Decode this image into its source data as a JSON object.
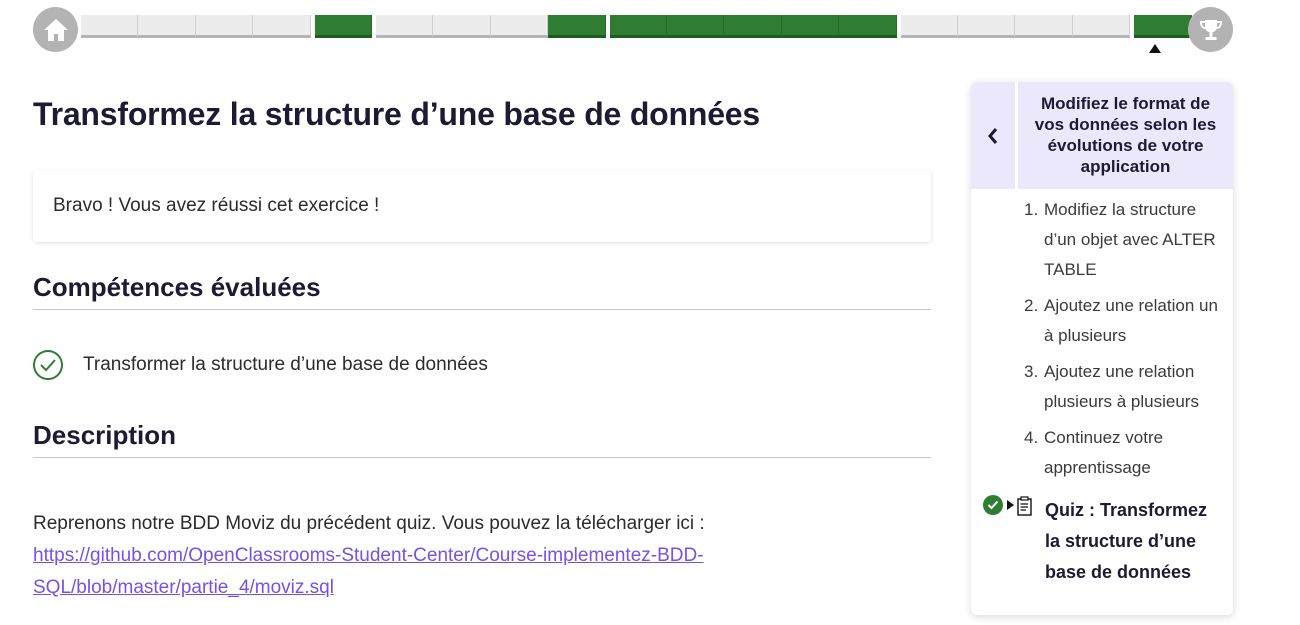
{
  "colors": {
    "accent_green": "#2e7d32",
    "link_purple": "#7451eb",
    "sidebar_header_bg": "#ebe8fb",
    "progress_empty": "#ececec",
    "nav_circle": "#b3b3b3"
  },
  "progress": {
    "home_icon": "home-icon",
    "trophy_icon": "trophy-icon",
    "segments": [
      {
        "done": false
      },
      {
        "done": false
      },
      {
        "done": false
      },
      {
        "done": false
      },
      {
        "done": true
      },
      {
        "done": false
      },
      {
        "done": false
      },
      {
        "done": false
      },
      {
        "done": true
      },
      {
        "done": true
      },
      {
        "done": true
      },
      {
        "done": true
      },
      {
        "done": true
      },
      {
        "done": true
      },
      {
        "done": false
      },
      {
        "done": false
      },
      {
        "done": false
      },
      {
        "done": false
      },
      {
        "done": true
      }
    ],
    "current_index": 18
  },
  "main": {
    "title": "Transformez la structure d’une base de données",
    "success_message": "Bravo ! Vous avez réussi cet exercice !",
    "skills_heading": "Compétences évaluées",
    "skills": [
      "Transformer la structure d’une base de données"
    ],
    "description_heading": "Description",
    "description_text": "Reprenons notre BDD Moviz du précédent quiz. Vous pouvez la télécharger ici :",
    "description_link": "https://github.com/OpenClassrooms-Student-Center/Course-implementez-BDD-SQL/blob/master/partie_4/moviz.sql"
  },
  "sidebar": {
    "back_icon": "chevron-left-icon",
    "title": "Modifiez le format de vos données selon les évolutions de votre application",
    "items": [
      {
        "num": "1.",
        "label": "Modifiez la structure d’un objet avec ALTER TABLE"
      },
      {
        "num": "2.",
        "label": "Ajoutez une relation un à plusieurs"
      },
      {
        "num": "3.",
        "label": "Ajoutez une relation plusieurs à plusieurs"
      },
      {
        "num": "4.",
        "label": "Continuez votre apprentissage"
      }
    ],
    "quiz_label": "Quiz : Transformez la structure d’une base de données"
  }
}
